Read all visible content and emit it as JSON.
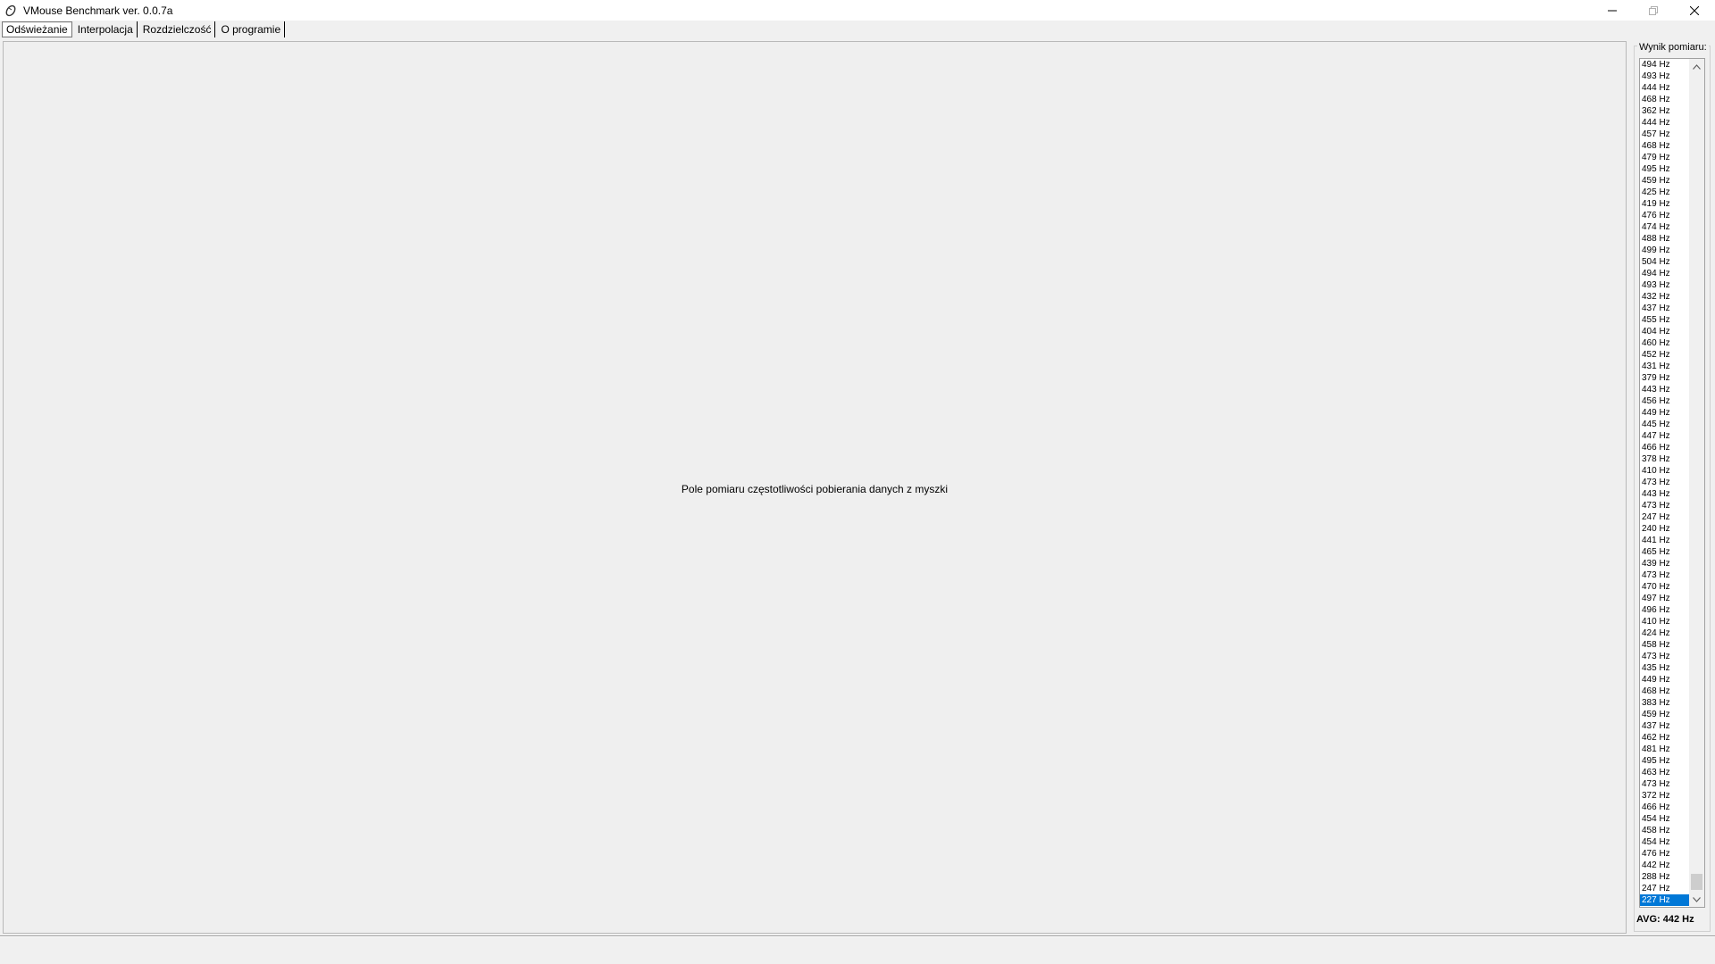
{
  "window": {
    "title": "VMouse Benchmark ver. 0.0.7a",
    "minimize_icon": "minimize-icon",
    "restore_icon": "restore-icon",
    "close_icon": "close-icon"
  },
  "tabs": [
    {
      "label": "Odświeżanie",
      "active": true
    },
    {
      "label": "Interpolacja",
      "active": false
    },
    {
      "label": "Rozdzielczość",
      "active": false
    },
    {
      "label": "O programie",
      "active": false
    }
  ],
  "measure": {
    "label": "Pole pomiaru częstotliwości pobierania danych z myszki"
  },
  "results": {
    "title": "Wynik pomiaru:",
    "items": [
      "494 Hz",
      "493 Hz",
      "444 Hz",
      "468 Hz",
      "362 Hz",
      "444 Hz",
      "457 Hz",
      "468 Hz",
      "479 Hz",
      "495 Hz",
      "459 Hz",
      "425 Hz",
      "419 Hz",
      "476 Hz",
      "474 Hz",
      "488 Hz",
      "499 Hz",
      "504 Hz",
      "494 Hz",
      "493 Hz",
      "432 Hz",
      "437 Hz",
      "455 Hz",
      "404 Hz",
      "460 Hz",
      "452 Hz",
      "431 Hz",
      "379 Hz",
      "443 Hz",
      "456 Hz",
      "449 Hz",
      "445 Hz",
      "447 Hz",
      "466 Hz",
      "378 Hz",
      "410 Hz",
      "473 Hz",
      "443 Hz",
      "473 Hz",
      "247 Hz",
      "240 Hz",
      "441 Hz",
      "465 Hz",
      "439 Hz",
      "473 Hz",
      "470 Hz",
      "497 Hz",
      "496 Hz",
      "410 Hz",
      "424 Hz",
      "458 Hz",
      "473 Hz",
      "435 Hz",
      "449 Hz",
      "468 Hz",
      "383 Hz",
      "459 Hz",
      "437 Hz",
      "462 Hz",
      "481 Hz",
      "495 Hz",
      "463 Hz",
      "473 Hz",
      "372 Hz",
      "466 Hz",
      "454 Hz",
      "458 Hz",
      "454 Hz",
      "476 Hz",
      "442 Hz",
      "288 Hz",
      "247 Hz",
      "227 Hz"
    ],
    "selected_index": 72,
    "avg": "AVG: 442 Hz"
  },
  "colors": {
    "selection": "#0078d7",
    "background": "#f0f0f0"
  }
}
